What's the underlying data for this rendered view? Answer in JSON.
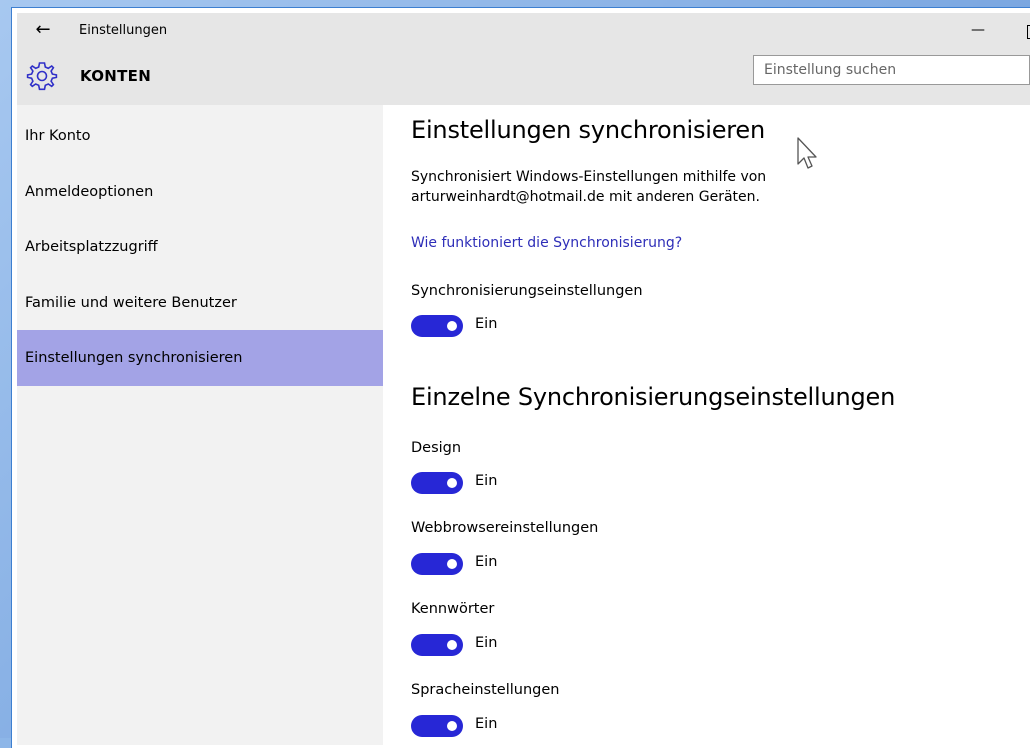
{
  "window": {
    "title": "Einstellungen",
    "back_icon": "back-arrow-icon",
    "minimize_icon": "minimize-icon"
  },
  "header": {
    "section_icon": "gear-icon",
    "section_title": "KONTEN",
    "search_placeholder": "Einstellung suchen"
  },
  "sidebar": {
    "items": [
      {
        "label": "Ihr Konto",
        "active": false
      },
      {
        "label": "Anmeldeoptionen",
        "active": false
      },
      {
        "label": "Arbeitsplatzzugriff",
        "active": false
      },
      {
        "label": "Familie und weitere Benutzer",
        "active": false
      },
      {
        "label": "Einstellungen synchronisieren",
        "active": true
      }
    ],
    "active_color": "#a3a3e6"
  },
  "main": {
    "title": "Einstellungen synchronisieren",
    "description_line1": "Synchronisiert Windows-Einstellungen mithilfe von",
    "description_line2": "arturweinhardt@hotmail.de mit anderen Geräten.",
    "help_link": "Wie funktioniert die Synchronisierung?",
    "sync_toggle": {
      "label": "Synchronisierungseinstellungen",
      "state": "Ein",
      "on": true
    },
    "individual_title": "Einzelne Synchronisierungseinstellungen",
    "toggles": [
      {
        "label": "Design",
        "state": "Ein",
        "on": true
      },
      {
        "label": "Webbrowsereinstellungen",
        "state": "Ein",
        "on": true
      },
      {
        "label": "Kennwörter",
        "state": "Ein",
        "on": true
      },
      {
        "label": "Spracheinstellungen",
        "state": "Ein",
        "on": true
      }
    ],
    "toggle_color": "#2727d6",
    "link_color": "#2e2eb8"
  }
}
